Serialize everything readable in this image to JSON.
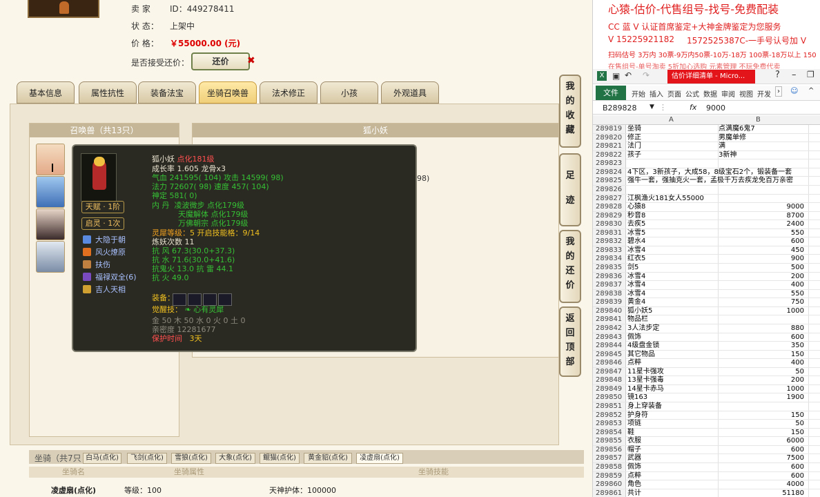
{
  "seller": {
    "seller_label": "卖 家",
    "seller_id": "ID：449278411",
    "status_label": "状 态：",
    "status_value": "上架中",
    "price_label": "价 格：",
    "price_value": "￥55000.00 (元)",
    "haggle_label": "是否接受还价：",
    "haggle_button": "还价"
  },
  "tabs": [
    "基本信息",
    "属性抗性",
    "装备法宝",
    "坐骑召唤兽",
    "法术修正",
    "小孩",
    "外观道具"
  ],
  "active_tab": "坐骑召唤兽",
  "summon_panel": {
    "title": "召唤兽（共13只）"
  },
  "right_panel": {
    "title": "狐小妖",
    "extra": "98)"
  },
  "tooltip": {
    "name": "狐小妖",
    "level": "点化181级",
    "growth": "成长率 1.605 龙骨x3",
    "hp": "气血 241595( 104) 攻击 14599( 98)",
    "mp": "法力 72607( 98) 速度 457( 104)",
    "defense": "神定 581( 0)",
    "neidan_label": "内 丹",
    "neidan1": "凌波微步 点化179级",
    "neidan2": "天魔解体 点化179级",
    "neidan3": "万佛朝宗 点化179级",
    "lingxi": "灵犀等级：",
    "lingxi_val": "5 开启技能格：9/14",
    "lianyao": "炼妖次数 11",
    "res_wind": "抗 风 67.3(30.0+37.3)",
    "res_water": "抗 水 71.6(30.0+41.6)",
    "res_ghost": "抗鬼火 13.0 抗 雷 44.1",
    "res_fire": "抗 火 49.0",
    "equip": "装备：",
    "awaken": "觉醒技：",
    "awaken_skill": "心有灵犀",
    "elements": "金 50 木 50 水 0 火 0 土 0",
    "intimacy": "亲密度 12281677",
    "protect_label": "保护时间",
    "protect_value": "3天",
    "talent_tag": "天赋 · 1阶",
    "spirit_tag": "启灵 · 1次",
    "skills": [
      "大隐于朝",
      "风火燎原",
      "扶伤",
      "福禄双全(6)",
      "吉人天相"
    ]
  },
  "side_buttons": [
    "我的收藏",
    "足迹",
    "我的还价",
    "返回顶部"
  ],
  "mounts": {
    "label": "坐骑（共7只",
    "tabs": [
      "白马(点化)",
      "飞剑(点化)",
      "雪狼(点化)",
      "大象(点化)",
      "鲲猫(点化)",
      "黄金貂(点化)",
      "凌虚扇(点化)"
    ],
    "active_tab": "凌虚扇(点化)",
    "head_name": "坐骑名",
    "head_attr": "坐骑属性",
    "head_skill": "坐骑技能",
    "row_name": "凌虚扇(点化)",
    "row_level": "等级：100",
    "row_skill": "天神护体：100000"
  },
  "banner": {
    "line1": "心猿-估价-代售组号-找号-免费配装",
    "line2": "CC 蓝 V 认证首席鉴定+大神金牌鉴定为您服务",
    "line3": "V 15225921182",
    "line4": "1572525387C-一手号认号加 V",
    "line5": "扫码估号 3万内 30票-9万内50票-10万-18万 100票-18万以上 150",
    "line6": "在售组号-单号淘卖 5折加心选购 元素管理 不玩免费代卖"
  },
  "excel": {
    "window_title": "估价详细清单 - Micro...",
    "file_tab": "文件",
    "ribbon_tabs": [
      "开始",
      "插入",
      "页面",
      "公式",
      "数据",
      "审阅",
      "视图",
      "开发"
    ],
    "cell_ref": "B289828",
    "fx": "fx",
    "formula_value": "9000",
    "col_a": "A",
    "col_b": "B",
    "rows": [
      {
        "n": "289819",
        "a": "坐骑",
        "b": "点满魔6鬼7",
        "num": false
      },
      {
        "n": "289820",
        "a": "修正",
        "b": "男魔单修",
        "num": false
      },
      {
        "n": "289821",
        "a": "法门",
        "b": "满",
        "num": false
      },
      {
        "n": "289822",
        "a": "孩子",
        "b": "3新神",
        "num": false
      },
      {
        "n": "289823",
        "a": "",
        "b": "",
        "num": false
      },
      {
        "n": "289824",
        "a": "4下区，3新孩子，大成58，8级宝石2个，锻装备一套",
        "b": "",
        "num": false
      },
      {
        "n": "289825",
        "a": "强牛一套，强抽克火一套，孟极千万去疾龙免百万亲密",
        "b": "",
        "num": false
      },
      {
        "n": "289826",
        "a": "",
        "b": "",
        "num": false
      },
      {
        "n": "289827",
        "a": "江枫渔火181女人55000",
        "b": "",
        "num": false
      },
      {
        "n": "289828",
        "a": "心猿8",
        "b": "9000",
        "num": true
      },
      {
        "n": "289829",
        "a": "秒音8",
        "b": "8700",
        "num": true
      },
      {
        "n": "289830",
        "a": "去疾5",
        "b": "2400",
        "num": true
      },
      {
        "n": "289831",
        "a": "冰雪5",
        "b": "550",
        "num": true
      },
      {
        "n": "289832",
        "a": "碧水4",
        "b": "600",
        "num": true
      },
      {
        "n": "289833",
        "a": "冰雪4",
        "b": "450",
        "num": true
      },
      {
        "n": "289834",
        "a": "红衣5",
        "b": "900",
        "num": true
      },
      {
        "n": "289835",
        "a": "剑5",
        "b": "500",
        "num": true
      },
      {
        "n": "289836",
        "a": "冰雪4",
        "b": "200",
        "num": true
      },
      {
        "n": "289837",
        "a": "冰雪4",
        "b": "400",
        "num": true
      },
      {
        "n": "289838",
        "a": "冰雪4",
        "b": "550",
        "num": true
      },
      {
        "n": "289839",
        "a": "黄金4",
        "b": "750",
        "num": true
      },
      {
        "n": "289840",
        "a": "狐小妖5",
        "b": "1000",
        "num": true
      },
      {
        "n": "289841",
        "a": "物品栏",
        "b": "",
        "num": false
      },
      {
        "n": "289842",
        "a": "3人法步定",
        "b": "880",
        "num": true
      },
      {
        "n": "289843",
        "a": "佩饰",
        "b": "600",
        "num": true
      },
      {
        "n": "289844",
        "a": "4级盘金锁",
        "b": "350",
        "num": true
      },
      {
        "n": "289845",
        "a": "其它物品",
        "b": "150",
        "num": true
      },
      {
        "n": "289846",
        "a": "点粹",
        "b": "400",
        "num": true
      },
      {
        "n": "289847",
        "a": "11星卡强攻",
        "b": "50",
        "num": true
      },
      {
        "n": "289848",
        "a": "13星卡强毒",
        "b": "200",
        "num": true
      },
      {
        "n": "289849",
        "a": "14星卡赤马",
        "b": "1000",
        "num": true
      },
      {
        "n": "289850",
        "a": "镜163",
        "b": "1900",
        "num": true
      },
      {
        "n": "289851",
        "a": "身上穿装备",
        "b": "",
        "num": false
      },
      {
        "n": "289852",
        "a": "护身符",
        "b": "150",
        "num": true
      },
      {
        "n": "289853",
        "a": "项链",
        "b": "50",
        "num": true
      },
      {
        "n": "289854",
        "a": "鞋",
        "b": "150",
        "num": true
      },
      {
        "n": "289855",
        "a": "衣服",
        "b": "6000",
        "num": true
      },
      {
        "n": "289856",
        "a": "帽子",
        "b": "600",
        "num": true
      },
      {
        "n": "289857",
        "a": "武器",
        "b": "7500",
        "num": true
      },
      {
        "n": "289858",
        "a": "佩饰",
        "b": "600",
        "num": true
      },
      {
        "n": "289859",
        "a": "点粹",
        "b": "600",
        "num": true
      },
      {
        "n": "289860",
        "a": "角色",
        "b": "4000",
        "num": true
      },
      {
        "n": "289861",
        "a": "共计",
        "b": "51180",
        "num": true
      }
    ]
  },
  "colors": {
    "accent": "#217346",
    "price": "#dd0000",
    "banner": "#e02020"
  }
}
